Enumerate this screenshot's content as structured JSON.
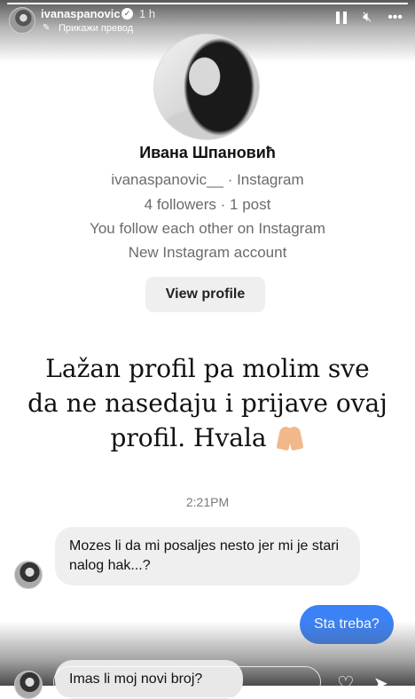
{
  "header": {
    "username": "ivanaspanovic",
    "time": "1 h",
    "translate_label": "Прикажи превод",
    "progress": 1.0
  },
  "profile": {
    "name": "Ивана Шпановић",
    "handle_line": "ivanaspanovic__ · Instagram",
    "stats_line": "4 followers · 1 post",
    "follow_line": "You follow each other on Instagram",
    "account_line": "New Instagram account",
    "view_button": "View profile"
  },
  "caption": {
    "line1": "Lažan profil pa molim sve",
    "line2": "da ne nasedaju i prijave ovaj",
    "line3": "profil. Hvala"
  },
  "chat": {
    "timestamp": "2:21PM",
    "messages": [
      {
        "from": "them",
        "text": "Mozes li da mi posaljes nesto jer mi je stari nalog hak...?"
      },
      {
        "from": "me",
        "text": "Sta treba?"
      },
      {
        "from": "them",
        "text": "Imas li moj novi broj?"
      }
    ]
  },
  "icons": {
    "verified": "verified-badge-icon",
    "pause": "pause-icon",
    "mute": "mute-icon",
    "more": "more-icon",
    "heart": "heart-icon",
    "send": "send-icon"
  },
  "colors": {
    "outgoing_bubble": "#3b82f6",
    "incoming_bubble": "#efefef"
  }
}
